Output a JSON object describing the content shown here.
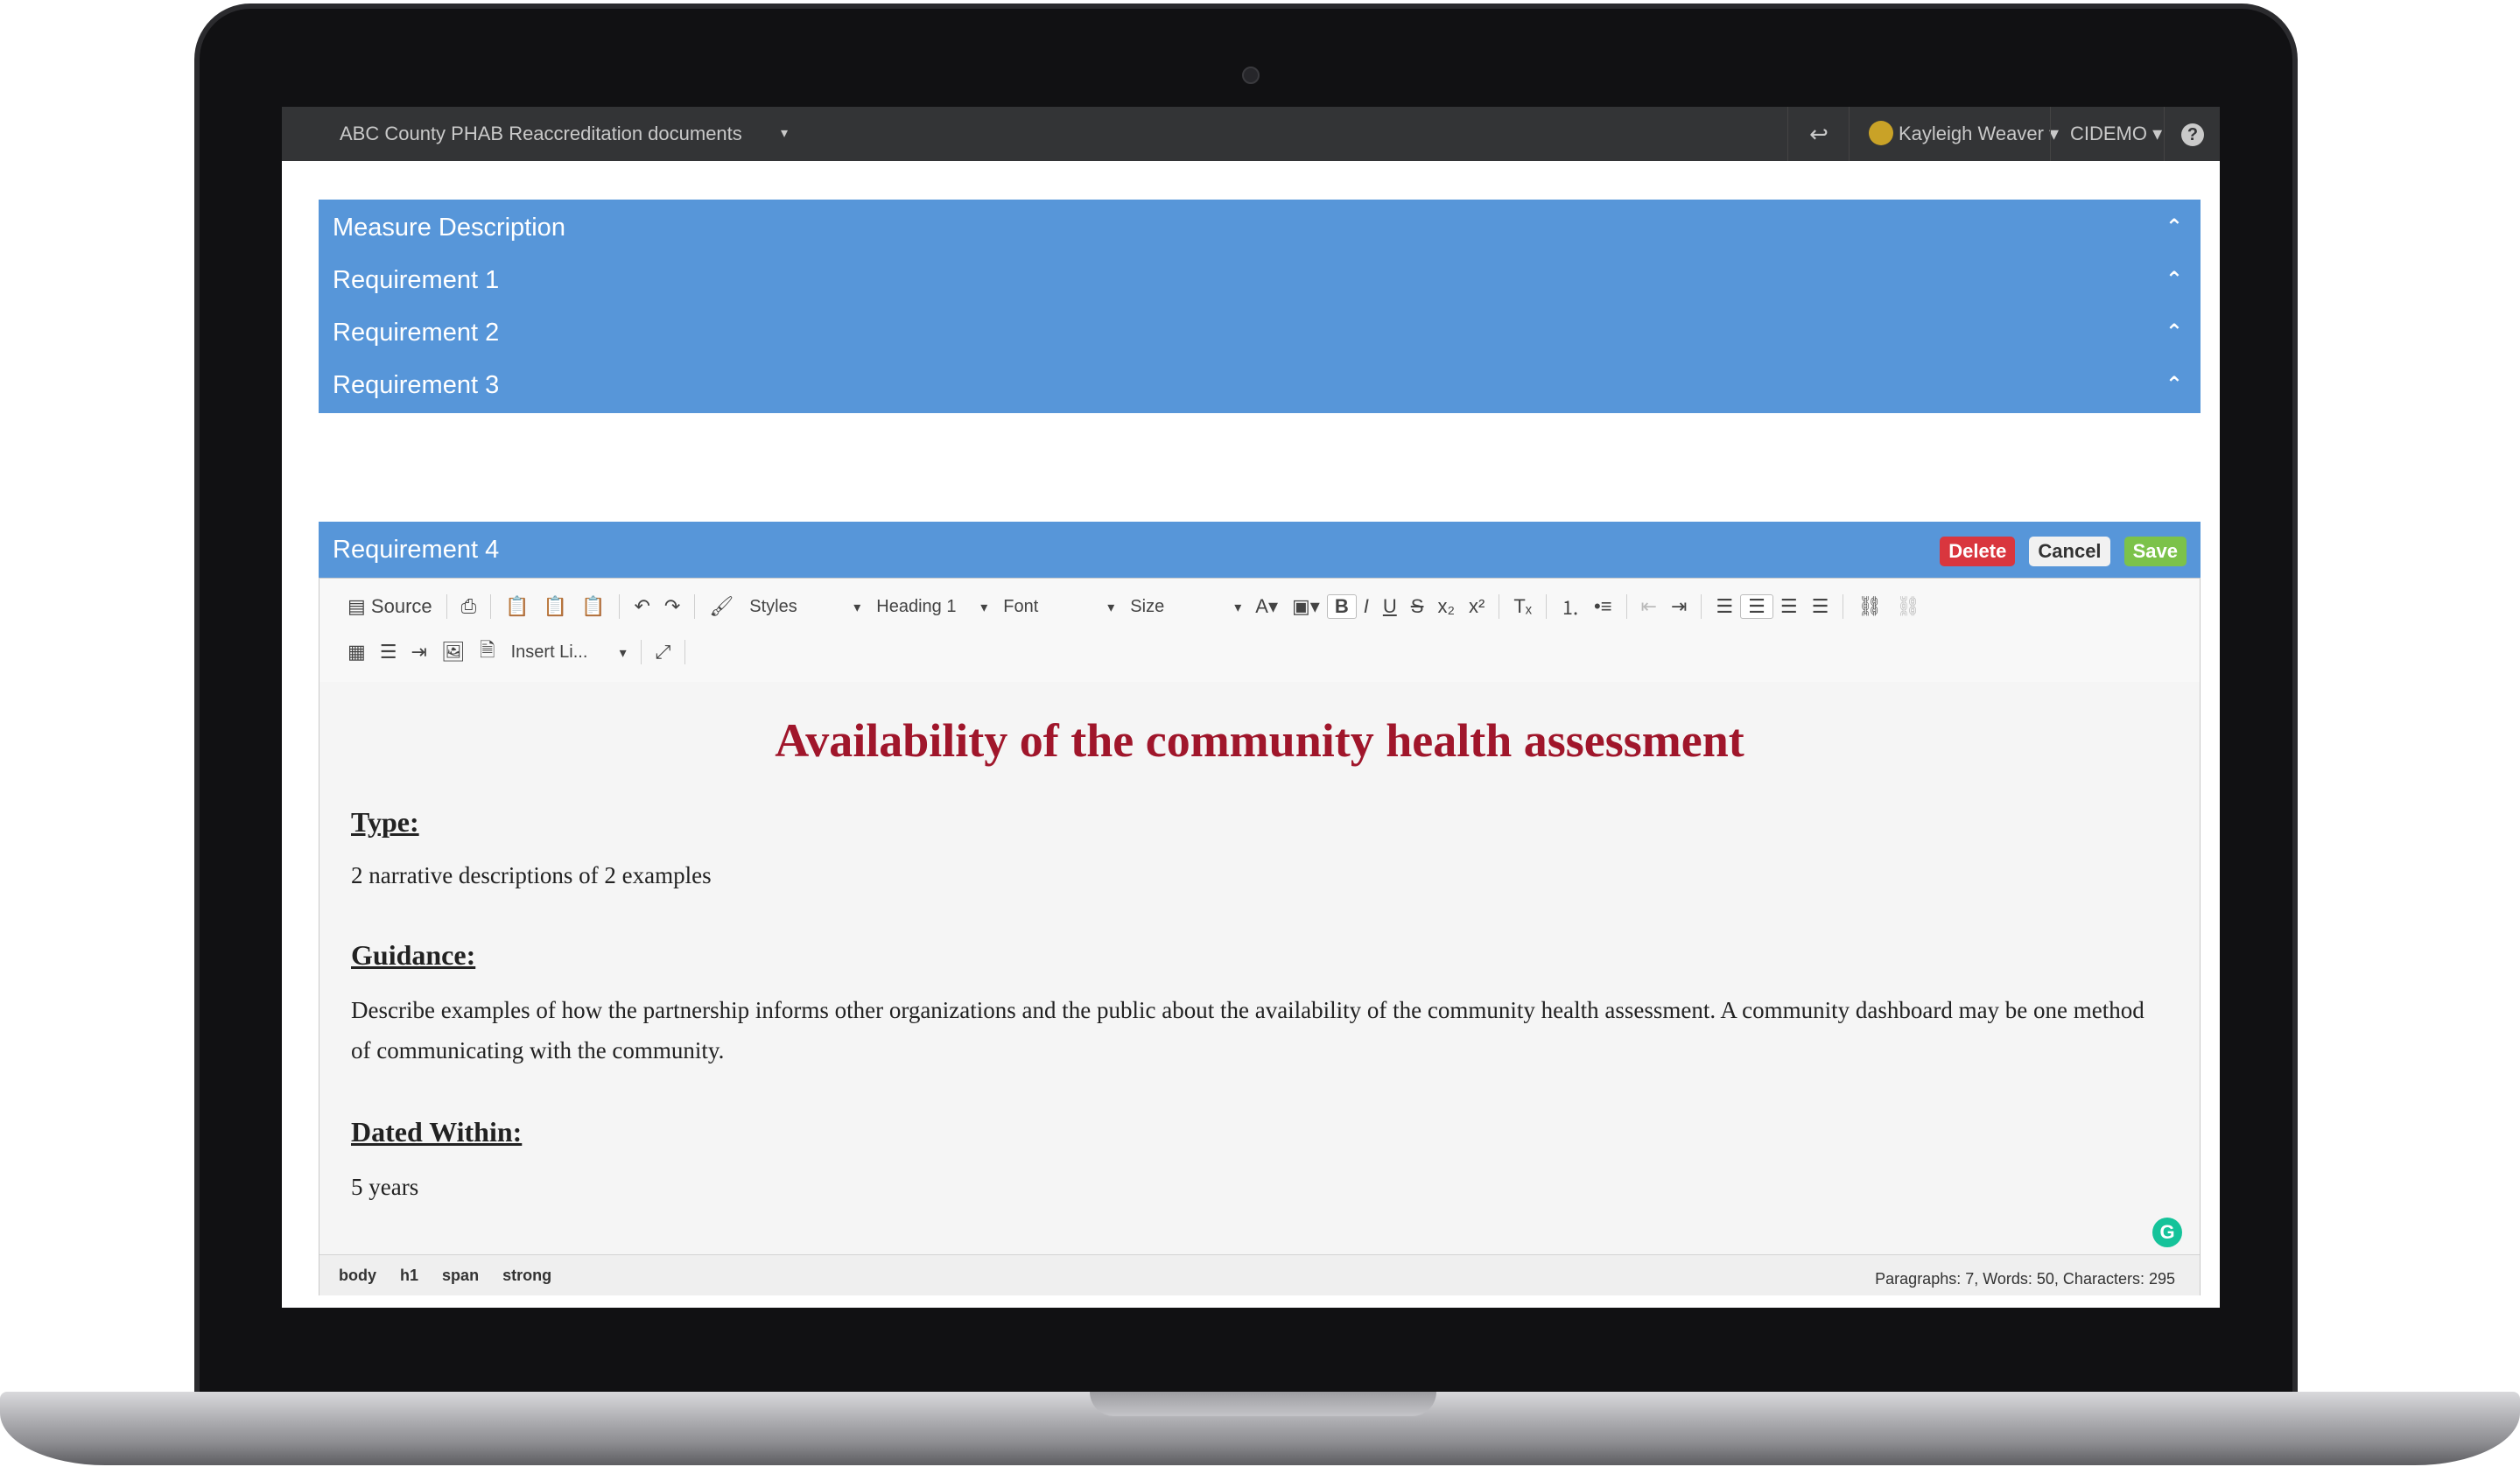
{
  "topbar": {
    "doc_title": "ABC County PHAB Reaccreditation documents",
    "doc_caret": "▾",
    "back_icon": "↩",
    "user_name": "Kayleigh Weaver ▾",
    "org_name": "CIDEMO ▾",
    "help_icon": "?"
  },
  "panels": [
    {
      "title": "Measure Description"
    },
    {
      "title": "Requirement 1"
    },
    {
      "title": "Requirement 2"
    },
    {
      "title": "Requirement 3"
    },
    {
      "title": "Requirement 4"
    }
  ],
  "chevron": "⌃",
  "actions": {
    "delete": "Delete",
    "cancel": "Cancel",
    "save": "Save"
  },
  "toolbar": {
    "source": "Source",
    "styles": "Styles",
    "format": "Heading 1",
    "font": "Font",
    "size": "Size",
    "insert_link": "Insert Li..."
  },
  "content": {
    "heading": "Availability of the community health assessment",
    "type_label": "Type:",
    "type_text": "2 narrative descriptions of 2 examples",
    "guidance_label": "Guidance:",
    "guidance_text": "Describe examples of how the partnership informs other organizations and the public about the availability of the community health assessment. A community dashboard may be one method of communicating with the community.",
    "dated_label": "Dated Within:",
    "dated_text": "5 years"
  },
  "grammarly": "G",
  "statusbar": {
    "path": [
      "body",
      "h1",
      "span",
      "strong"
    ],
    "wordcount": "Paragraphs: 7, Words: 50, Characters: 295"
  },
  "colors": {
    "panel": "#5796d9",
    "heading": "#a0162b",
    "delete": "#d9363e",
    "save": "#7cc24a"
  }
}
